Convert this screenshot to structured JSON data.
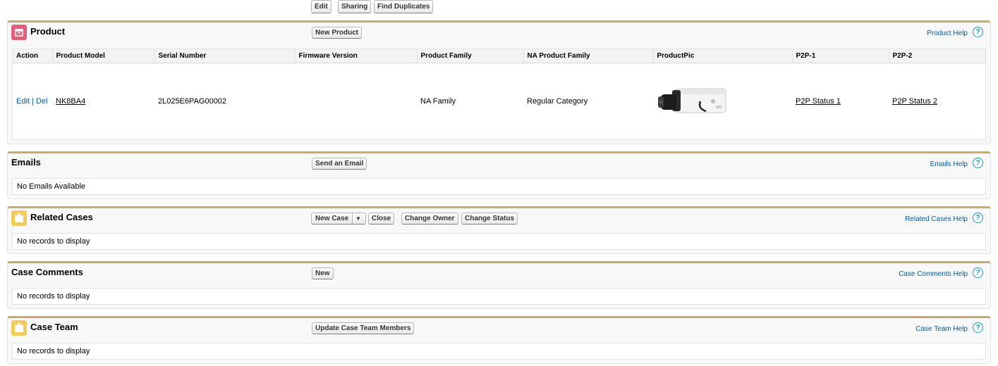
{
  "top_buttons": {
    "edit": "Edit",
    "sharing": "Sharing",
    "find_duplicates": "Find Duplicates"
  },
  "product": {
    "title": "Product",
    "new_button": "New Product",
    "help": "Product Help",
    "help_q": "?",
    "columns": [
      "Action",
      "Product Model",
      "Serial Number",
      "Firmware Version",
      "Product Family",
      "NA Product Family",
      "ProductPic",
      "P2P-1",
      "P2P-2"
    ],
    "row": {
      "edit": "Edit",
      "sep": "|",
      "del": "Del",
      "product_model": "NK8BA4",
      "serial_number": "2L025E6PAG00002",
      "firmware_version": "",
      "product_family": "NA Family",
      "na_product_family": "Regular Category",
      "p2p1": "P2P Status 1",
      "p2p2": "P2P Status 2"
    }
  },
  "emails": {
    "title": "Emails",
    "button": "Send an Email",
    "help": "Emails Help",
    "help_q": "?",
    "empty": "No Emails Available"
  },
  "related_cases": {
    "title": "Related Cases",
    "new_case": "New Case",
    "dropdown_arrow": "▼",
    "close": "Close",
    "change_owner": "Change Owner",
    "change_status": "Change Status",
    "help": "Related Cases Help",
    "help_q": "?",
    "empty": "No records to display"
  },
  "case_comments": {
    "title": "Case Comments",
    "button": "New",
    "help": "Case Comments Help",
    "help_q": "?",
    "empty": "No records to display"
  },
  "case_team": {
    "title": "Case Team",
    "button": "Update Case Team Members",
    "help": "Case Team Help",
    "help_q": "?",
    "empty": "No records to display"
  },
  "colors": {
    "product_icon": "#e0607e",
    "case_icon": "#f1cb5e",
    "block_border_top": "#c4ad6b",
    "link": "#015ba7"
  }
}
